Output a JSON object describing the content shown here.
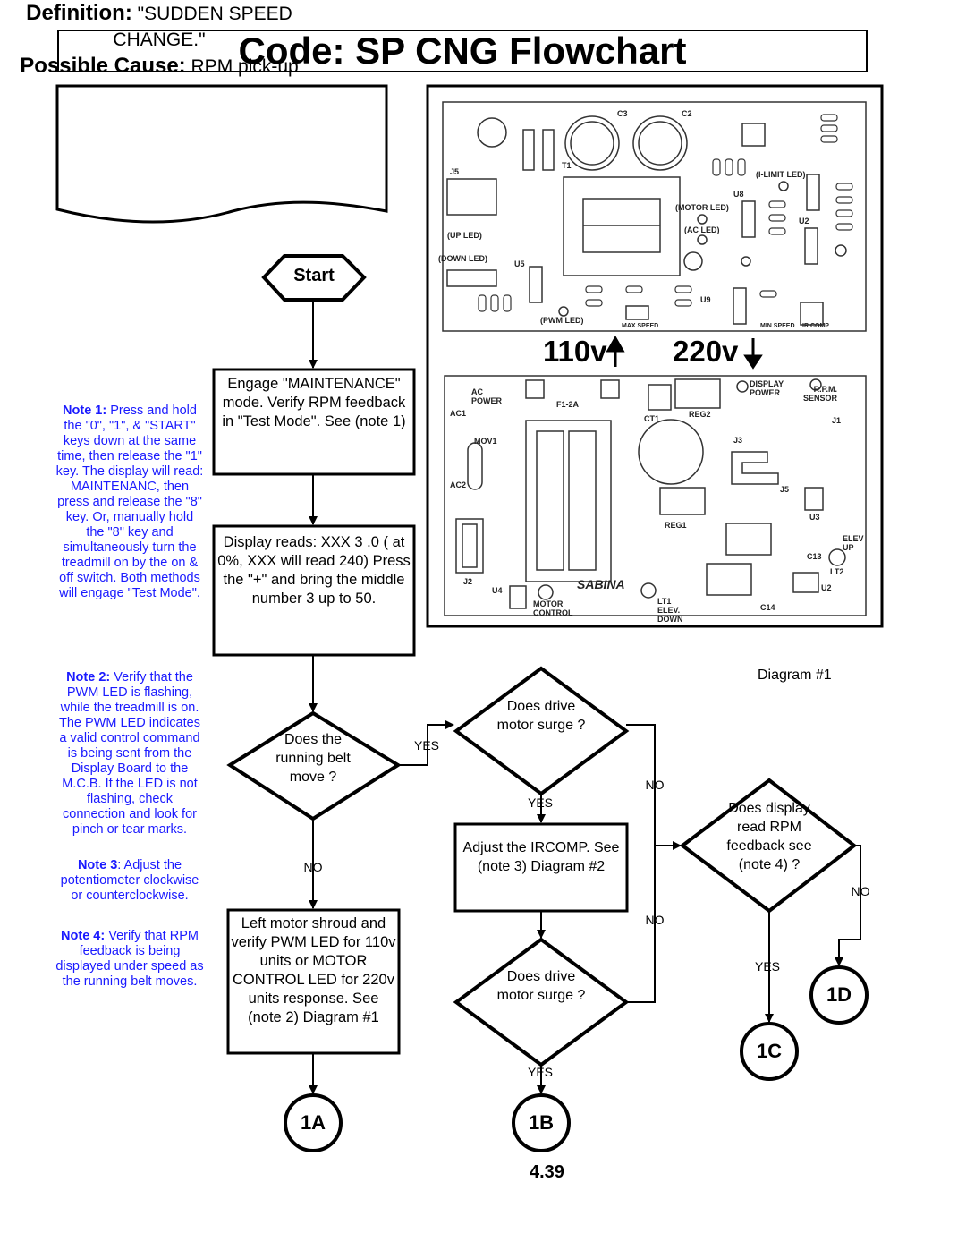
{
  "title": "Code: SP CNG Flowchart",
  "definition": {
    "label": "Definition:",
    "text": "\"SUDDEN SPEED CHANGE.\"",
    "cause_label": "Possible Cause:",
    "cause_text": "RPM pick-up misaligned."
  },
  "notes": [
    {
      "label": "Note 1:",
      "text": "Press and hold the \"0\", \"1\", & \"START\" keys down at the same time, then release the \"1\" key. The display will read: MAINTENANC, then press and release the \"8\" key. Or, manually hold the \"8\" key and simultaneously turn the treadmill on by the on & off switch. Both methods will engage \"Test Mode\"."
    },
    {
      "label": "Note 2:",
      "text": "Verify that the PWM LED is flashing, while the treadmill is on. The PWM LED indicates a valid control command is being sent from the Display Board to the M.C.B. If the LED is not flashing, check connection and look for pinch or tear marks."
    },
    {
      "label": "Note 3",
      "text": ": Adjust the potentiometer clockwise or counterclockwise."
    },
    {
      "label": "Note 4:",
      "text": "Verify that RPM feedback is being displayed under speed as the running belt moves."
    }
  ],
  "flow": {
    "start": "Start",
    "engage": "Engage \"MAINTENANCE\" mode. Verify RPM feedback in \"Test Mode\". See (note 1)",
    "display": "Display reads: XXX   3  .0 ( at 0%, XXX will read 240) Press the \"+\" and bring the middle number 3 up to 50.",
    "belt_move": "Does the running belt move ?",
    "left_motor": "Left motor shroud and verify PWM LED for 110v units or MOTOR CONTROL  LED for 220v units response. See (note 2) Diagram #1",
    "surge1": "Does drive motor surge ?",
    "adjust": "Adjust the IRCOMP. See (note 3) Diagram #2",
    "surge2": "Does drive motor surge ?",
    "rpm_feedback": "Does display read RPM feedback see (note 4) ?",
    "end_1a": "1A",
    "end_1b": "1B",
    "end_1c": "1C",
    "end_1d": "1D",
    "yes": "YES",
    "no": "NO"
  },
  "diagram": {
    "caption": "Diagram #1",
    "label_110v": "110v",
    "label_220v": "220v",
    "top_board_labels": [
      "C3",
      "C2",
      "T1",
      "J5",
      "(UP LED)",
      "(DOWN LED)",
      "(MOTOR LED)",
      "(AC LED)",
      "(I-LIMIT LED)",
      "(PWM LED)",
      "U5",
      "U8",
      "U2",
      "U9",
      "MAX SPEED",
      "MIN SPEED",
      "IR COMP"
    ],
    "bottom_board_labels": [
      "AC POWER",
      "AC1",
      "AC2",
      "MOV1",
      "J2",
      "U4",
      "F1-2A",
      "REG2",
      "REG1",
      "CT1",
      "DISPLAY POWER",
      "R.P.M. SENSOR",
      "J1",
      "J3",
      "J5",
      "U3",
      "C13",
      "LT2",
      "U2",
      "C14",
      "LT1 ELEV. DOWN",
      "ELEV UP",
      "MOTOR CONTROL",
      "SABINA"
    ]
  },
  "page_number": "4.39"
}
